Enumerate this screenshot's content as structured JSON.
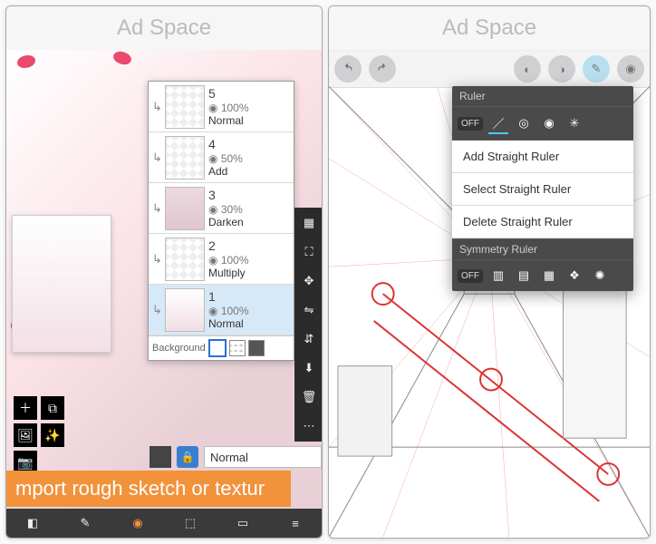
{
  "ad_label": "Ad Space",
  "left": {
    "layers": [
      {
        "num": "5",
        "opacity": "100%",
        "blend": "Normal",
        "sel": false
      },
      {
        "num": "4",
        "opacity": "50%",
        "blend": "Add",
        "sel": false
      },
      {
        "num": "3",
        "opacity": "30%",
        "blend": "Darken",
        "sel": false
      },
      {
        "num": "2",
        "opacity": "100%",
        "blend": "Multiply",
        "sel": false
      },
      {
        "num": "1",
        "opacity": "100%",
        "blend": "Normal",
        "sel": true
      }
    ],
    "background_label": "Background",
    "blend_mode": "Normal",
    "tooltip": "mport rough sketch or textur"
  },
  "right": {
    "ruler": {
      "title": "Ruler",
      "off": "OFF",
      "menu": [
        "Add Straight Ruler",
        "Select Straight Ruler",
        "Delete Straight Ruler"
      ],
      "sym_title": "Symmetry Ruler"
    }
  }
}
